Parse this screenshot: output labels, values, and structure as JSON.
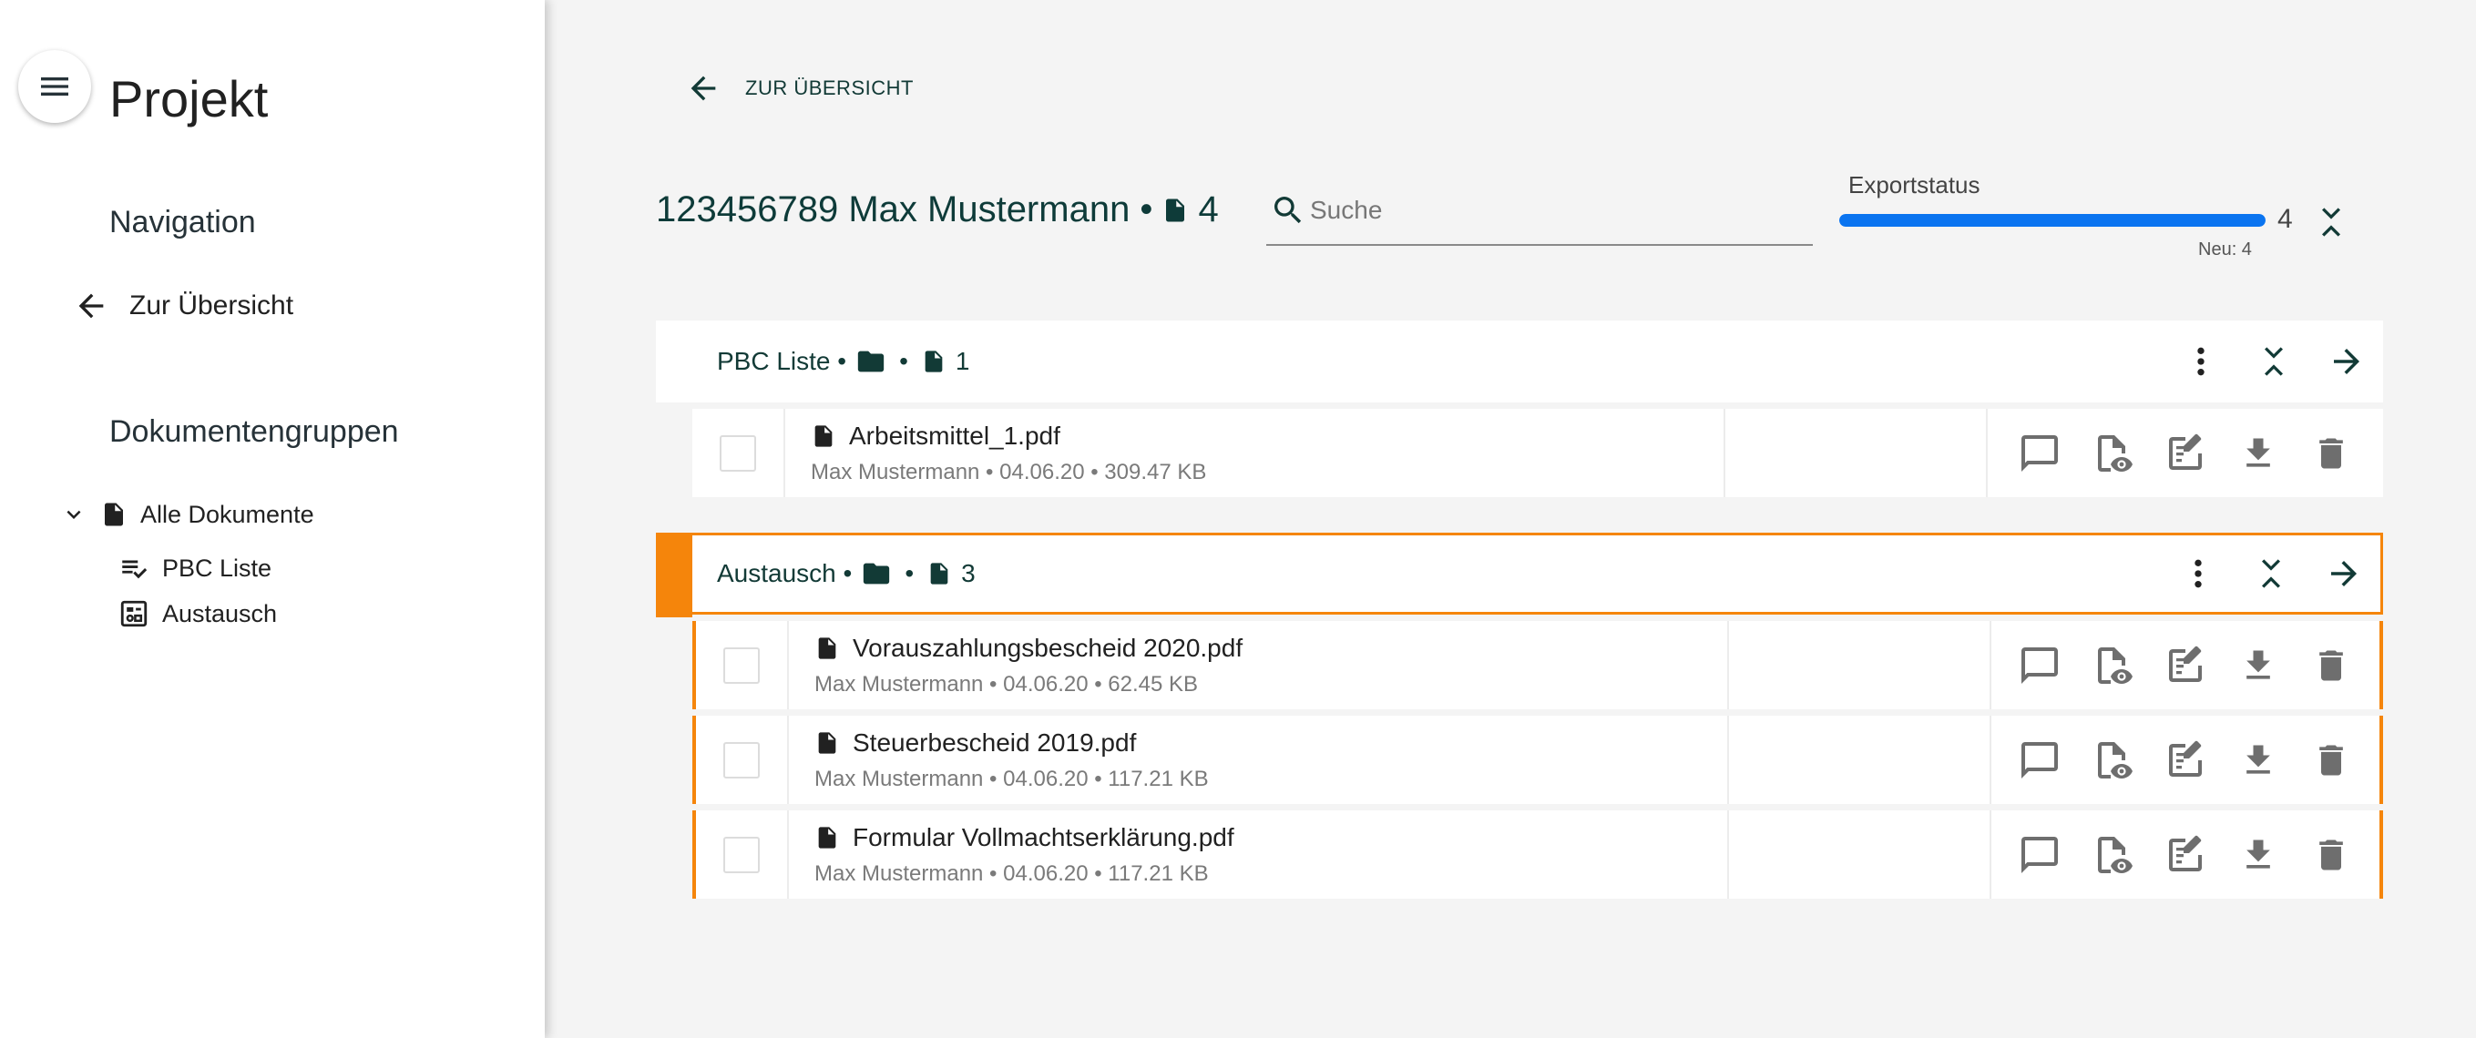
{
  "sidebar": {
    "title": "Projekt",
    "navigation_heading": "Navigation",
    "back_label": "Zur Übersicht",
    "groups_heading": "Dokumentengruppen",
    "tree": {
      "root_label": "Alle Dokumente",
      "items": [
        {
          "label": "PBC Liste",
          "icon": "playlist-check-icon"
        },
        {
          "label": "Austausch",
          "icon": "exchange-board-icon"
        }
      ]
    }
  },
  "header": {
    "back_label": "ZUR ÜBERSICHT",
    "title": "123456789 Max Mustermann •",
    "doc_count": "4",
    "search_placeholder": "Suche",
    "export": {
      "label": "Exportstatus",
      "count": "4",
      "new_label": "Neu: 4",
      "progress": 1.0
    }
  },
  "groups": [
    {
      "name": "PBC Liste •",
      "separator": "•",
      "file_count": "1",
      "selected": false,
      "documents": [
        {
          "name": "Arbeitsmittel_1.pdf",
          "meta": "Max Mustermann • 04.06.20 • 309.47 KB"
        }
      ]
    },
    {
      "name": "Austausch •",
      "separator": "•",
      "file_count": "3",
      "selected": true,
      "documents": [
        {
          "name": "Vorauszahlungsbescheid 2020.pdf",
          "meta": "Max Mustermann • 04.06.20 • 62.45 KB"
        },
        {
          "name": "Steuerbescheid 2019.pdf",
          "meta": "Max Mustermann • 04.06.20 • 117.21 KB"
        },
        {
          "name": "Formular Vollmachtserklärung.pdf",
          "meta": "Max Mustermann • 04.06.20 • 117.21 KB"
        }
      ]
    }
  ],
  "colors": {
    "accent": "#f5850b",
    "primary_text": "#123a36",
    "progress": "#0a74f0",
    "icon_gray": "#6e6e6e"
  }
}
